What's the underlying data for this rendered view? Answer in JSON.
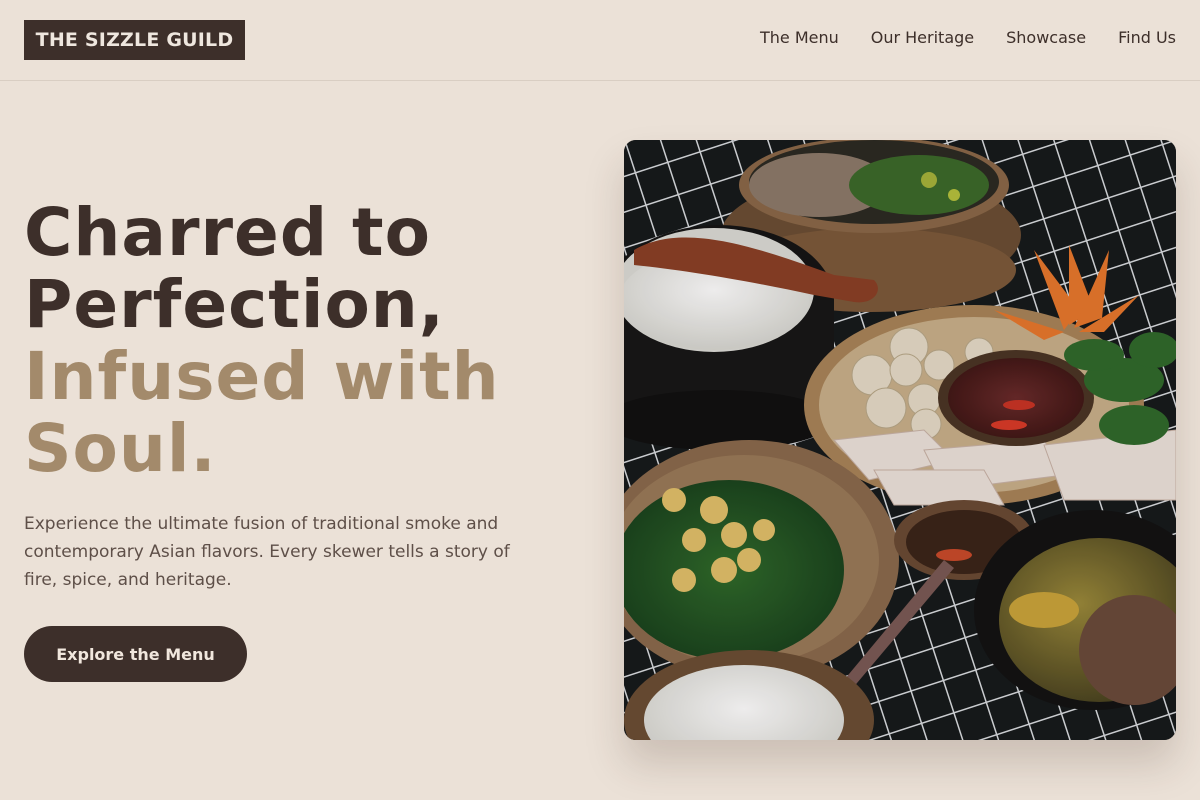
{
  "brand": {
    "name": "THE SIZZLE GUILD"
  },
  "nav": {
    "items": [
      {
        "label": "The Menu"
      },
      {
        "label": "Our Heritage"
      },
      {
        "label": "Showcase"
      },
      {
        "label": "Find Us"
      }
    ]
  },
  "hero": {
    "title_line1": "Charred to",
    "title_line2": "Perfection,",
    "title_line3": "Infused with",
    "title_line4": "Soul.",
    "description": "Experience the ultimate fusion of traditional smoke and contemporary Asian flavors. Every skewer tells a story of fire, spice, and heritage.",
    "cta_label": "Explore the Menu",
    "image_subject": "asian-food-spread-photo"
  },
  "colors": {
    "background": "#ebe1d7",
    "primary_dark": "#3d2f2a",
    "accent": "#a38a6b",
    "body_text": "#5e4f48"
  }
}
